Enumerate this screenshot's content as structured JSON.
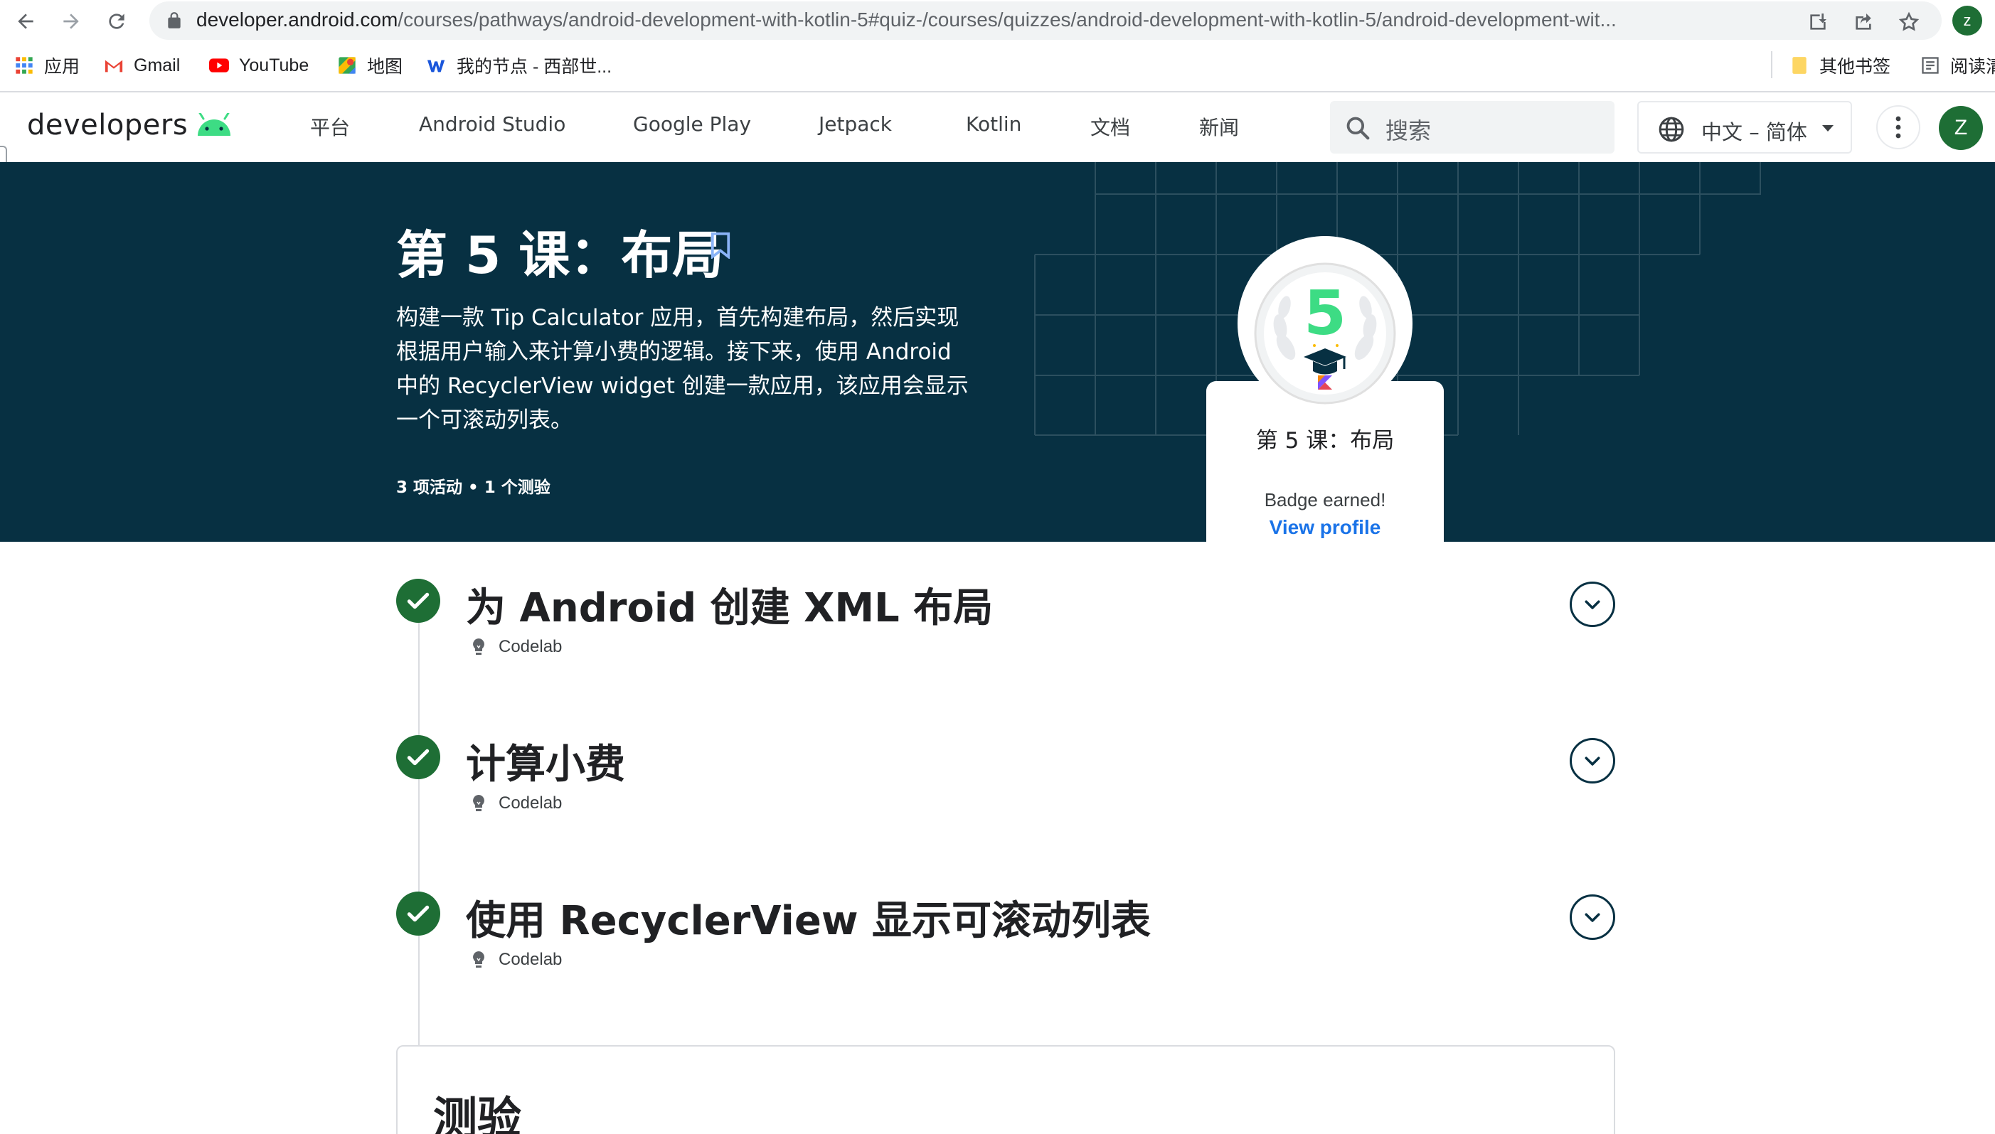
{
  "browser": {
    "url_host": "developer.android.com",
    "url_path": "/courses/pathways/android-development-with-kotlin-5#quiz-/courses/quizzes/android-development-with-kotlin-5/android-development-wit...",
    "profile_initial": "z",
    "bookmarks": [
      {
        "label": "应用",
        "icon": "apps-grid-icon"
      },
      {
        "label": "Gmail",
        "icon": "gmail-icon"
      },
      {
        "label": "YouTube",
        "icon": "youtube-icon"
      },
      {
        "label": "地图",
        "icon": "maps-icon"
      },
      {
        "label": "我的节点 - 西部世...",
        "icon": "w-icon"
      }
    ],
    "other_bookmarks": "其他书签",
    "reading_list": "阅读清"
  },
  "site": {
    "logo_text": "developers",
    "nav": [
      "平台",
      "Android Studio",
      "Google Play",
      "Jetpack",
      "Kotlin",
      "文档",
      "新闻"
    ],
    "search_placeholder": "搜索",
    "language": "中文 – 简体",
    "avatar_initial": "Z"
  },
  "hero": {
    "title": "第 5 课：布局",
    "description_lines": [
      "构建一款 Tip Calculator 应用，首先构建布局，然后实现",
      "根据用户输入来计算小费的逻辑。接下来，使用 Android",
      "中的 RecyclerView widget 创建一款应用，该应用会显示",
      "一个可滚动列表。"
    ],
    "meta": "3 项活动 • 1 个测验",
    "background": "#073042"
  },
  "badge": {
    "number": "5",
    "title": "第 5 课：布局",
    "earned_text": "Badge earned!",
    "link_text": "View profile",
    "number_color": "#3ddc84",
    "link_color": "#1a73e8"
  },
  "activities": [
    {
      "title": "为 Android 创建 XML 布局",
      "type": "Codelab",
      "completed": true
    },
    {
      "title": "计算小费",
      "type": "Codelab",
      "completed": true
    },
    {
      "title": "使用 RecyclerView 显示可滚动列表",
      "type": "Codelab",
      "completed": true
    }
  ],
  "quiz": {
    "title": "测验"
  },
  "colors": {
    "check_green": "#1e6e35",
    "android_green": "#3ddc84"
  }
}
